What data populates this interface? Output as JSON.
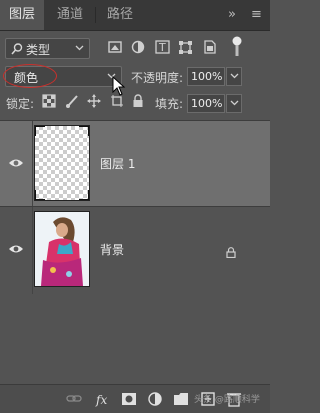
{
  "tabs": [
    {
      "label": "图层",
      "active": true
    },
    {
      "label": "通道",
      "active": false
    },
    {
      "label": "路径",
      "active": false
    }
  ],
  "panel_tools": {
    "collapse": "»",
    "menu": "≡"
  },
  "filter": {
    "label": "类型",
    "icons": [
      "image-filter-icon",
      "adjustment-filter-icon",
      "text-filter-icon",
      "shape-filter-icon",
      "smart-object-filter-icon",
      "filter-toggle-icon"
    ]
  },
  "blend_mode": {
    "value": "颜色"
  },
  "opacity": {
    "label": "不透明度:",
    "value": "100%"
  },
  "lock": {
    "label": "锁定:"
  },
  "fill": {
    "label": "填充:",
    "value": "100%"
  },
  "layers": [
    {
      "name": "图层 1",
      "selected": true,
      "visible": true,
      "thumbnail": "transparent"
    },
    {
      "name": "背景",
      "selected": false,
      "visible": true,
      "locked": true,
      "thumbnail": "photo"
    }
  ],
  "watermark": "头条 @路顺科学"
}
